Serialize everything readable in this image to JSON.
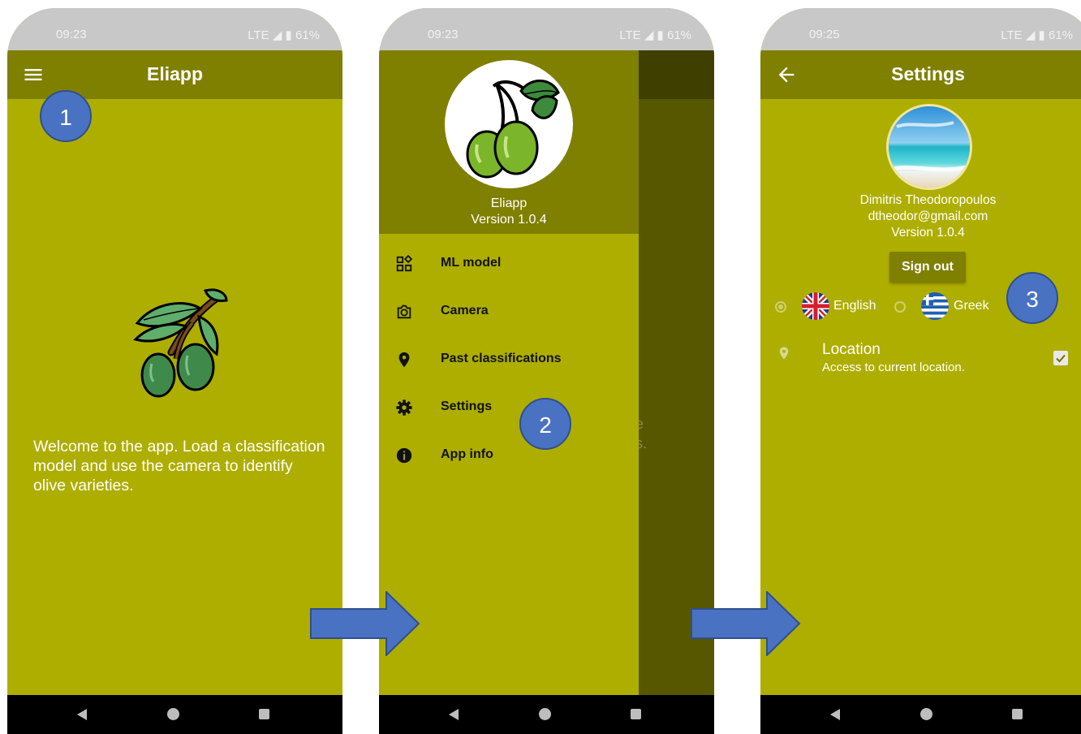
{
  "colors": {
    "appbar": "#7f7f00",
    "background": "#aeae00",
    "scrim": "#575700",
    "statusbar": "#c8c8c8",
    "badge": "#4a72c3",
    "arrow": "#4a72c3"
  },
  "screen1": {
    "status": {
      "time": "09:23",
      "indicators": "LTE ◢ ▮ 61%"
    },
    "appbar": {
      "title": "Eliapp",
      "menu_icon": "hamburger-menu-icon"
    },
    "welcome_text": "Welcome to the app. Load a classification model and use the camera to identify olive varieties.",
    "badge": "1"
  },
  "screen2": {
    "status": {
      "time": "09:23",
      "indicators": "LTE ◢ ▮ 61%"
    },
    "drawer": {
      "app_name": "Eliapp",
      "version": "Version 1.0.4",
      "items": [
        {
          "label": "ML model",
          "icon": "widgets-icon"
        },
        {
          "label": "Camera",
          "icon": "camera-icon"
        },
        {
          "label": "Past classifications",
          "icon": "location-pin-icon"
        },
        {
          "label": "Settings",
          "icon": "gear-icon"
        },
        {
          "label": "App info",
          "icon": "info-icon"
        }
      ]
    },
    "scrim_text": {
      "line1": "e",
      "line2": "s."
    },
    "badge": "2"
  },
  "screen3": {
    "status": {
      "time": "09:25",
      "indicators": "LTE ◢ ▮ 61%"
    },
    "appbar": {
      "title": "Settings",
      "back_icon": "back-arrow-icon"
    },
    "profile": {
      "name": "Dimitris Theodoropoulos",
      "email": "dtheodor@gmail.com",
      "version": "Version 1.0.4"
    },
    "sign_out": "Sign out",
    "languages": [
      {
        "label": "English",
        "selected": true,
        "flag": "uk-flag-icon"
      },
      {
        "label": "Greek",
        "selected": false,
        "flag": "greece-flag-icon"
      }
    ],
    "location": {
      "title": "Location",
      "subtitle": "Access to current location.",
      "checked": true
    },
    "badge": "3"
  }
}
